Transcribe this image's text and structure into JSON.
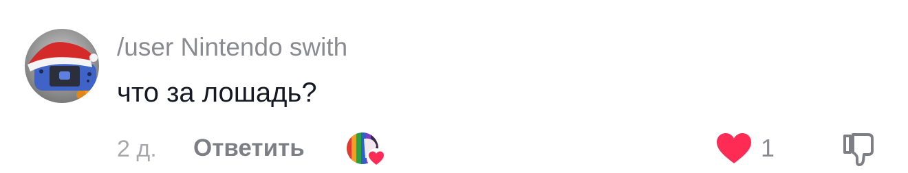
{
  "comment": {
    "username": "/user Nintendo swith",
    "text": "что за лошадь?",
    "timestamp": "2 д.",
    "reply_label": "Ответить",
    "like_count": "1"
  },
  "colors": {
    "heart": "#fe2c55",
    "muted_text": "#8a8b91",
    "primary_text": "#161823"
  },
  "icons": {
    "avatar": "user-avatar-image",
    "creator_like": "creator-liked-avatar-badge",
    "like": "heart-icon",
    "dislike": "thumbs-down-icon"
  }
}
